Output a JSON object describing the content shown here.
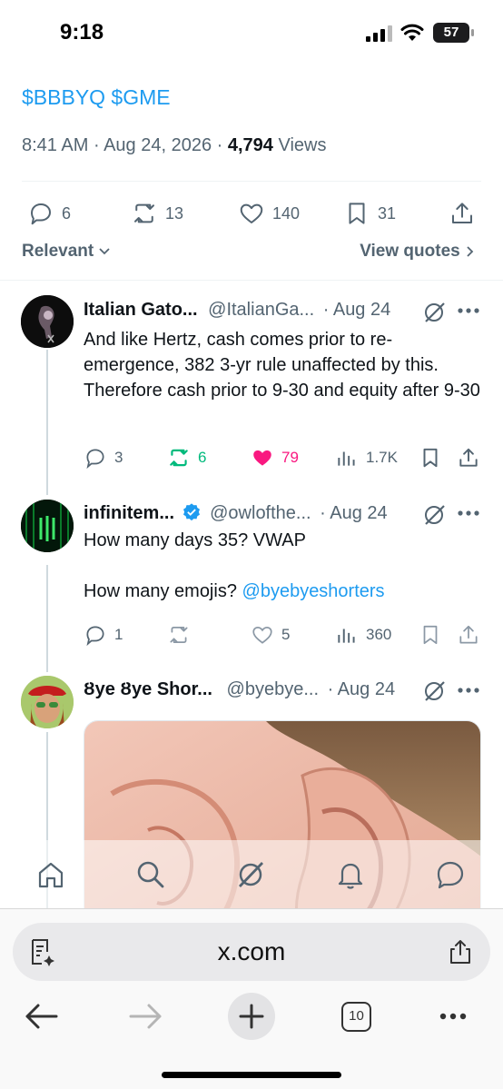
{
  "status_bar": {
    "time": "9:18",
    "battery": "57"
  },
  "main_tweet": {
    "text": "$BBBYQ $GME",
    "time": "8:41 AM",
    "date": "Aug 24, 2026",
    "views_count": "4,794",
    "views_label": "Views",
    "replies": "6",
    "reposts": "13",
    "likes": "140",
    "bookmarks": "31"
  },
  "sort": {
    "label": "Relevant",
    "view_quotes": "View quotes"
  },
  "replies": [
    {
      "name": "Italian Gato...",
      "handle": "@ItalianGa...",
      "date": "· Aug 24",
      "text": "And like Hertz, cash comes prior to re-emergence, 382 3-yr rule unaffected by this. Therefore cash prior to 9-30 and equity after 9-30",
      "replies": "3",
      "reposts": "6",
      "likes": "79",
      "views": "1.7K"
    },
    {
      "name": "infinitem...",
      "handle": "@owlofthe...",
      "date": "· Aug 24",
      "text_line1": "How many days 35? VWAP",
      "text_line2_prefix": "How many emojis? ",
      "mention": "@byebyeshorters",
      "replies": "1",
      "reposts": "",
      "likes": "5",
      "views": "360"
    },
    {
      "name": "Ȣye Ȣye Shor...",
      "handle": "@byebye...",
      "date": "· Aug 24"
    }
  ],
  "browser": {
    "url": "x.com",
    "tabs_count": "10"
  },
  "colors": {
    "accent": "#1d9bf0",
    "like": "#f91880",
    "repost": "#00ba7c",
    "muted": "#536471"
  }
}
